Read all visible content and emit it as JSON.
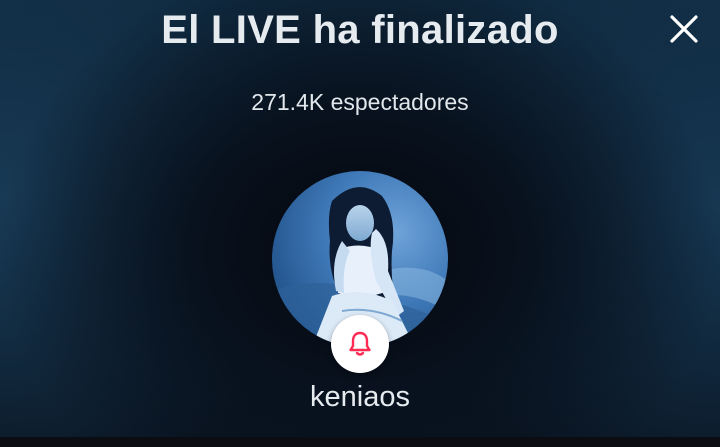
{
  "header": {
    "title": "El LIVE ha finalizado"
  },
  "stats": {
    "viewers_label": "271.4K espectadores"
  },
  "host": {
    "username": "keniaos"
  },
  "icons": {
    "close": "close-icon",
    "bell": "bell-icon"
  },
  "colors": {
    "bell_accent": "#fe2c55",
    "text": "#e6ebf0"
  }
}
